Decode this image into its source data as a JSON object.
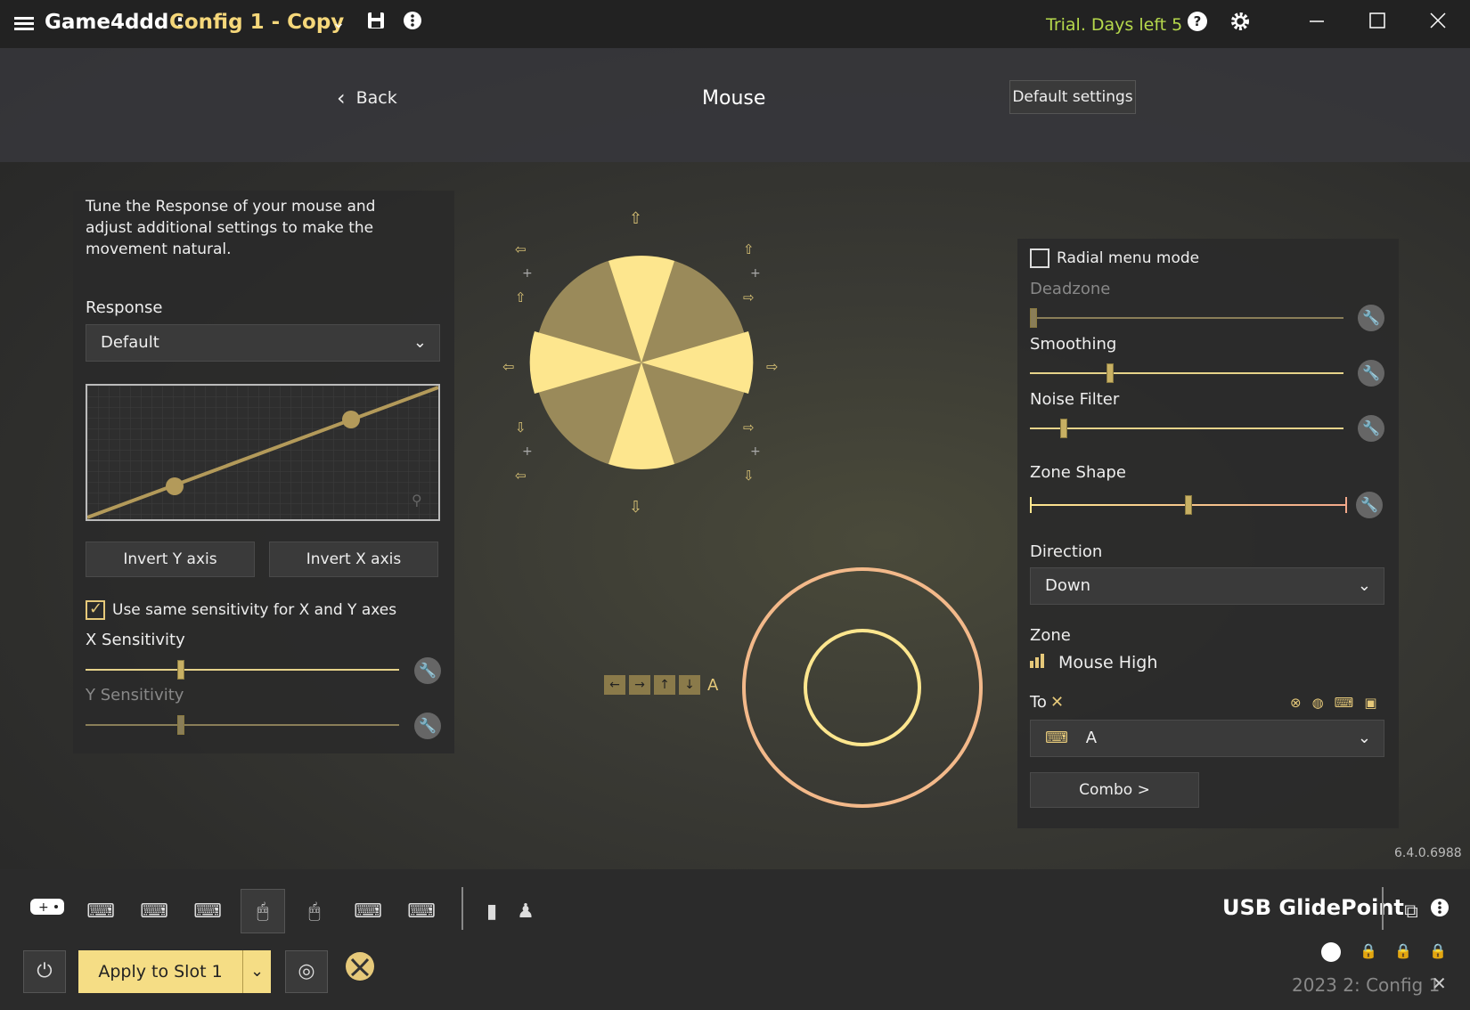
{
  "title_bar": {
    "app_name": "Game4ddd :",
    "config_name": "Config 1 - Copy",
    "trial_text": "Trial. Days left 5"
  },
  "header": {
    "back_label": "Back",
    "title": "Mouse",
    "default_settings_label": "Default settings"
  },
  "left_panel": {
    "description": "Tune the Response of your mouse and adjust additional settings to make the movement natural.",
    "response_label": "Response",
    "response_value": "Default",
    "invert_y_label": "Invert Y axis",
    "invert_x_label": "Invert X axis",
    "same_sensitivity_label": "Use same sensitivity for X and Y axes",
    "same_sensitivity_checked": true,
    "x_sensitivity_label": "X Sensitivity",
    "x_sensitivity_value": 0.3,
    "y_sensitivity_label": "Y Sensitivity",
    "y_sensitivity_value": 0.3
  },
  "right_panel": {
    "radial_menu_label": "Radial menu mode",
    "radial_menu_checked": false,
    "deadzone_label": "Deadzone",
    "deadzone_value": 0.0,
    "smoothing_label": "Smoothing",
    "smoothing_value": 0.25,
    "noise_filter_label": "Noise Filter",
    "noise_filter_value": 0.1,
    "zone_shape_label": "Zone Shape",
    "zone_shape_value": 0.5,
    "direction_label": "Direction",
    "direction_value": "Down",
    "zone_label": "Zone",
    "zone_value": "Mouse High",
    "to_label": "To",
    "to_value": "A",
    "combo_label": "Combo >"
  },
  "center": {
    "key_a_label": "A"
  },
  "version": "6.4.0.6988",
  "bottom": {
    "device_name": "USB GlidePoint",
    "apply_label": "Apply to Slot 1",
    "slot_label": "2023 2: Config 1"
  },
  "colors": {
    "accent": "#f5dd85",
    "trial_green": "#b6d94c",
    "config_gold": "#f5d77a",
    "outer_ring": "#f3b98a"
  }
}
